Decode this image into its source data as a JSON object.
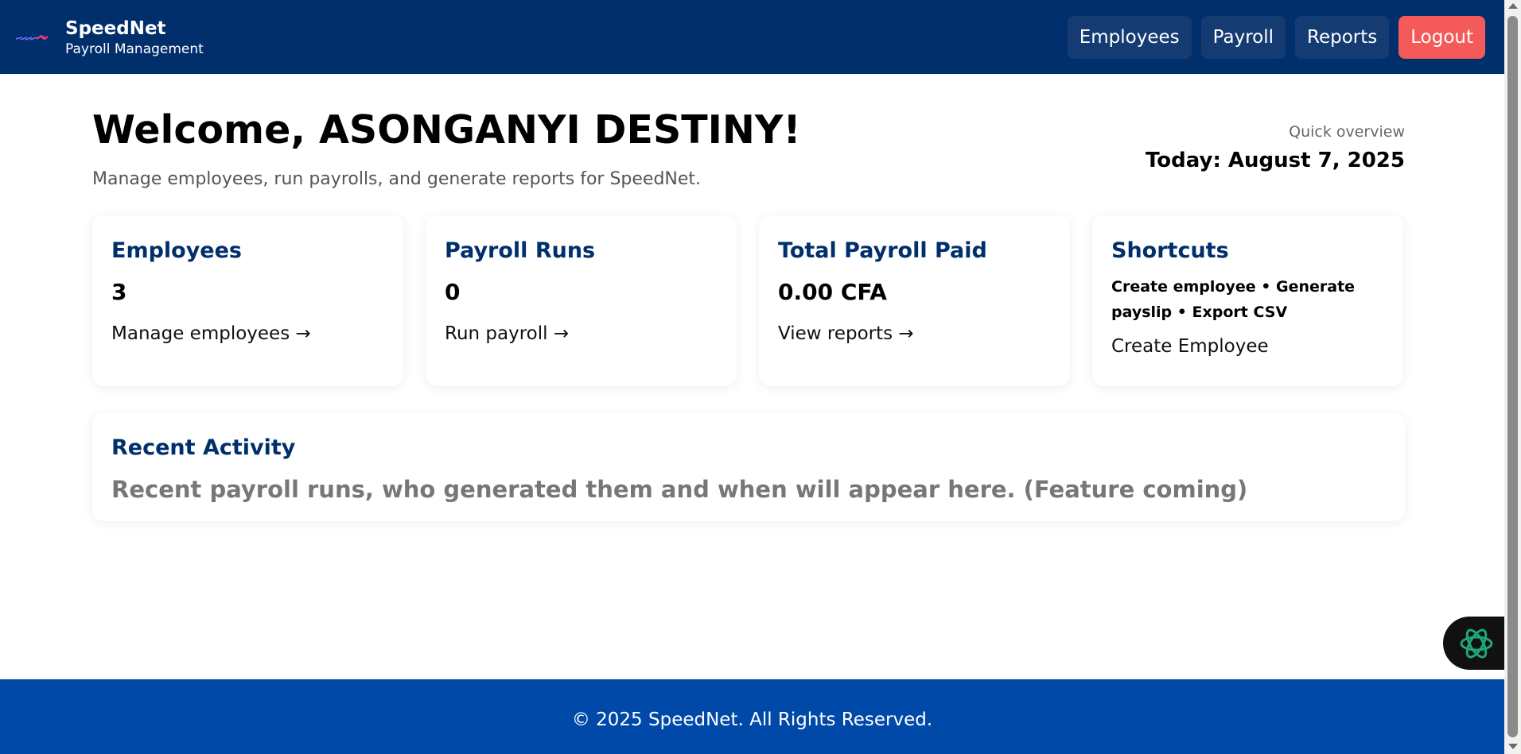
{
  "header": {
    "brand_name": "SpeedNet",
    "brand_sub": "Payroll Management",
    "nav": {
      "employees": "Employees",
      "payroll": "Payroll",
      "reports": "Reports",
      "logout": "Logout"
    }
  },
  "welcome": {
    "title": "Welcome, ASONGANYI DESTINY!",
    "subtitle": "Manage employees, run payrolls, and generate reports for SpeedNet.",
    "overview_label": "Quick overview",
    "today": "Today: August 7, 2025"
  },
  "cards": {
    "employees": {
      "title": "Employees",
      "value": "3",
      "link": "Manage employees →"
    },
    "payroll_runs": {
      "title": "Payroll Runs",
      "value": "0",
      "link": "Run payroll →"
    },
    "total_paid": {
      "title": "Total Payroll Paid",
      "value": "0.00 CFA",
      "link": "View reports →"
    },
    "shortcuts": {
      "title": "Shortcuts",
      "text": "Create employee • Generate payslip • Export CSV",
      "link": "Create Employee"
    }
  },
  "activity": {
    "title": "Recent Activity",
    "text": "Recent payroll runs, who generated them and when will appear here. (Feature coming)"
  },
  "footer": {
    "text": "© 2025 SpeedNet. All Rights Reserved."
  },
  "colors": {
    "header_bg": "#002f6c",
    "nav_bg": "#153b73",
    "logout_bg": "#f55a5a",
    "footer_bg": "#0049a8",
    "card_title": "#002f6c"
  },
  "icons": {
    "logo": "speednet-logo-icon",
    "assistant": "openai-assistant-icon"
  }
}
